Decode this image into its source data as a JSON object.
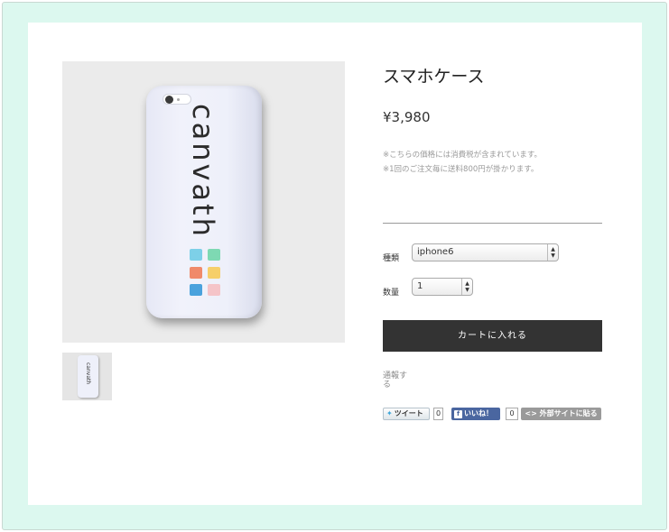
{
  "product": {
    "title": "スマホケース",
    "price": "¥3,980",
    "notes": [
      "※こちらの価格には消費税が含まれています。",
      "※1回のご注文毎に送料800円が掛かります。"
    ],
    "image_brand_text": "canvath"
  },
  "options": {
    "type_label": "種類",
    "type_value": "iphone6",
    "quantity_label": "数量",
    "quantity_value": "1"
  },
  "actions": {
    "add_to_cart": "カートに入れる",
    "report": "通報する"
  },
  "social": {
    "tweet_label": "ツイート",
    "tweet_count": "0",
    "like_label": "いいね！",
    "like_count": "0",
    "embed_label": "<> 外部サイトに貼る"
  },
  "colors": {
    "frame_bg": "#dcf8ef",
    "cart_button_bg": "#333333",
    "tiles": [
      "#7dd0e8",
      "#7ed9b3",
      "#f08a6a",
      "#f6cf6a",
      "#4aa2dd",
      "#f5c4c8"
    ]
  },
  "icons": {
    "tweet": "twitter-bird-icon",
    "like": "facebook-f-icon",
    "select_arrows": "updown-arrows-icon"
  }
}
